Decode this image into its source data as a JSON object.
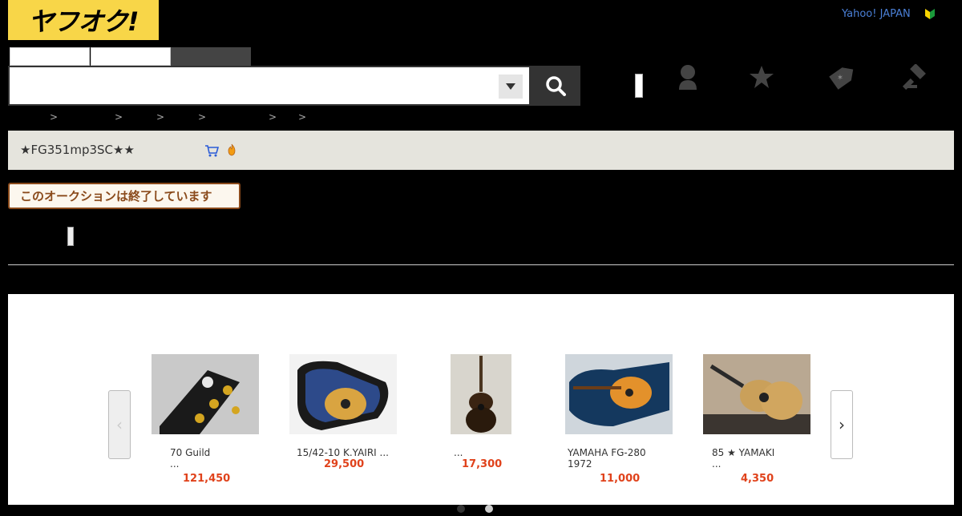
{
  "header": {
    "logo_text": "ヤフオク!",
    "yahoo_link": "Yahoo! JAPAN",
    "beginner_icon": "beginner-mark-icon"
  },
  "search": {
    "value": "",
    "placeholder": "",
    "dropdown_icon": "chevron-down-icon",
    "button_icon": "search-icon"
  },
  "nav_icons": [
    "user-icon",
    "star-icon",
    "tag-icon",
    "gavel-icon"
  ],
  "breadcrumb": {
    "separators": [
      ">",
      ">",
      ">",
      ">",
      ">",
      ">"
    ]
  },
  "auction": {
    "title": "★FG351mp3SC★★",
    "cart_icon": "cart-icon",
    "status_icon": "fire-icon",
    "ended_label": "このオークションは終了しています"
  },
  "recommendations": {
    "prev_label": "‹",
    "next_label": "›",
    "items": [
      {
        "title": "70 Guild\n...",
        "price": "121,450"
      },
      {
        "title": "15/42-10 K.YAIRI ...",
        "price": "29,500"
      },
      {
        "title": "...",
        "price": "17,300"
      },
      {
        "title": "YAMAHA FG-280\n1972",
        "price": "11,000"
      },
      {
        "title": "85 ★  YAMAKI\n...",
        "price": "4,350"
      }
    ]
  },
  "colors": {
    "brand_yellow": "#f8d648",
    "price_red": "#e0421b",
    "ended_brown": "#8a4a1b",
    "link_blue": "#4a7fd6"
  }
}
